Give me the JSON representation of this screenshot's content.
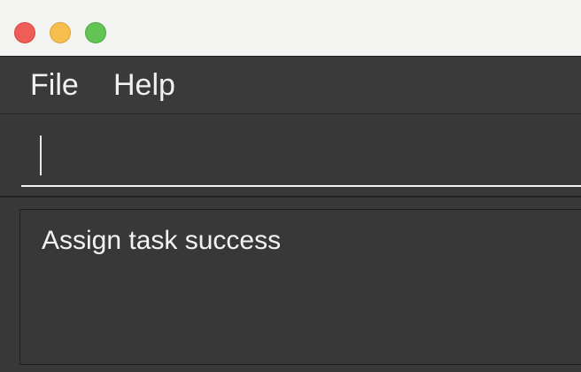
{
  "window": {
    "controls": [
      "close",
      "minimize",
      "maximize"
    ]
  },
  "menu": {
    "file_label": "File",
    "help_label": "Help"
  },
  "command_box": {
    "value": "",
    "placeholder": ""
  },
  "result_display": {
    "message": "Assign task success"
  },
  "colors": {
    "close": "#ee5d57",
    "minimize": "#f6bd4f",
    "maximize": "#61c454",
    "background": "#383838",
    "text": "#f1f1f1"
  }
}
